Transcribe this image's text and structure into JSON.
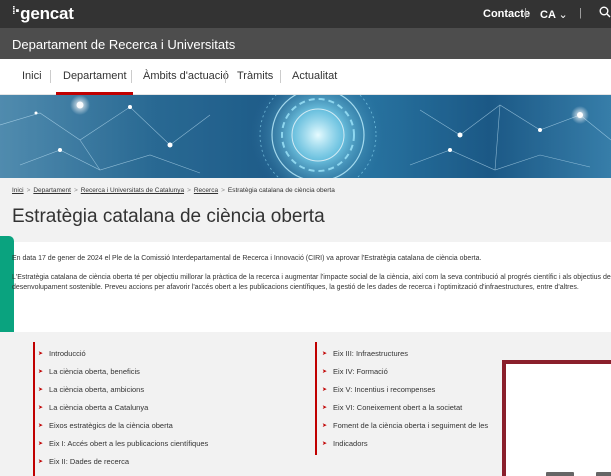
{
  "header": {
    "logo": "gencat",
    "logo_mark": "⁞▪",
    "contact": "Contacte",
    "language": "CA",
    "language_chevron": "⌄",
    "separator": "|",
    "search_icon": "search-icon"
  },
  "department": {
    "title": "Departament de Recerca i Universitats"
  },
  "nav": {
    "items": [
      "Inici",
      "Departament",
      "Àmbits d'actuació",
      "Tràmits",
      "Actualitat"
    ],
    "active": "Departament"
  },
  "breadcrumb": {
    "items": [
      "Inici",
      "Departament",
      "Recerca i Universitats de Catalunya",
      "Recerca",
      "Estratègia catalana de ciència oberta"
    ],
    "separator": ">"
  },
  "page": {
    "title": "Estratègia catalana de ciència oberta",
    "intro1": "En data 17 de gener de 2024 el Ple de la Comissió Interdepartamental de Recerca i Innovació (CIRI) va aprovar l'Estratègia catalana de ciència oberta.",
    "intro2": "L'Estratègia catalana de ciència oberta té per objectiu millorar la pràctica de la recerca i augmentar l'impacte social de la ciència, així com la seva contribució al progrés científic i als objectius de desenvolupament sostenible. Preveu accions per afavorir l'accés obert a les publicacions científiques, la gestió de les dades de recerca i l'optimització d'infraestructures, entre d'altres."
  },
  "menu": {
    "arrow": "➤",
    "left": [
      "Introducció",
      "La ciència oberta, beneficis",
      "La ciència oberta, ambicions",
      "La ciència oberta a Catalunya",
      "Eixos estratègics de la ciència oberta",
      "Eix I: Accés obert a les publicacions científiques",
      "Eix II: Dades de recerca"
    ],
    "right": [
      "Eix III: Infraestructures",
      "Eix IV: Formació",
      "Eix V: Incentius i recompenses",
      "Eix VI: Coneixement obert a la societat",
      "Foment de la ciència oberta i seguiment de les",
      "Indicadors"
    ]
  },
  "colors": {
    "topbar": "#333333",
    "deptbar": "#4d4d4d",
    "accent": "#c00000",
    "side_badge": "#0aa37f",
    "modal_border": "#8a1f2b"
  }
}
